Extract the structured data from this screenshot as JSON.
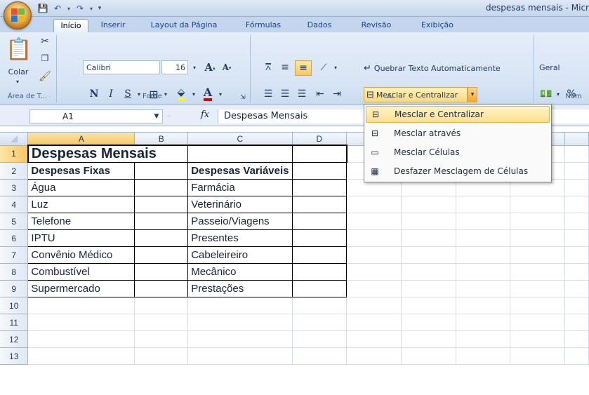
{
  "window": {
    "title": "despesas mensais - Micr"
  },
  "tabs": [
    "Início",
    "Inserir",
    "Layout da Página",
    "Fórmulas",
    "Dados",
    "Revisão",
    "Exibição"
  ],
  "ribbon": {
    "clipboard": {
      "paste_label": "Colar",
      "group_label": "Área de T..."
    },
    "font": {
      "family": "Calibri",
      "size": "16",
      "bold": "N",
      "italic": "I",
      "underline": "S",
      "grow": "A",
      "shrink": "A",
      "color_glyph": "A",
      "group_label": "Fonte"
    },
    "alignment": {
      "wrap_label": "Quebrar Texto Automaticamente",
      "merge_label": "Mesclar e Centralizar",
      "group_label": "Al"
    },
    "number": {
      "format": "Geral",
      "percent": "%",
      "group_label": "Núm"
    }
  },
  "formula_bar": {
    "name_box": "A1",
    "fx": "fx",
    "content": "Despesas Mensais"
  },
  "columns": [
    "A",
    "B",
    "C",
    "D"
  ],
  "rows": [
    {
      "n": "1",
      "a": "Despesas Mensais",
      "c": ""
    },
    {
      "n": "2",
      "a": "Despesas Fixas",
      "c": "Despesas Variáveis"
    },
    {
      "n": "3",
      "a": "Água",
      "c": "Farmácia"
    },
    {
      "n": "4",
      "a": "Luz",
      "c": "Veterinário"
    },
    {
      "n": "5",
      "a": "Telefone",
      "c": "Passeio/Viagens"
    },
    {
      "n": "6",
      "a": "IPTU",
      "c": "Presentes"
    },
    {
      "n": "7",
      "a": "Convênio Médico",
      "c": "Cabeleireiro"
    },
    {
      "n": "8",
      "a": "Combustível",
      "c": "Mecânico"
    },
    {
      "n": "9",
      "a": "Supermercado",
      "c": "Prestações"
    },
    {
      "n": "10",
      "a": "",
      "c": ""
    },
    {
      "n": "11",
      "a": "",
      "c": ""
    },
    {
      "n": "12",
      "a": "",
      "c": ""
    },
    {
      "n": "13",
      "a": "",
      "c": ""
    }
  ],
  "merge_menu": {
    "items": [
      "Mesclar e Centralizar",
      "Mesclar através",
      "Mesclar Células",
      "Desfazer Mesclagem de Células"
    ]
  },
  "colors": {
    "accent": "#15428b",
    "selection": "#f8c868",
    "highlight": "#fde08b"
  }
}
